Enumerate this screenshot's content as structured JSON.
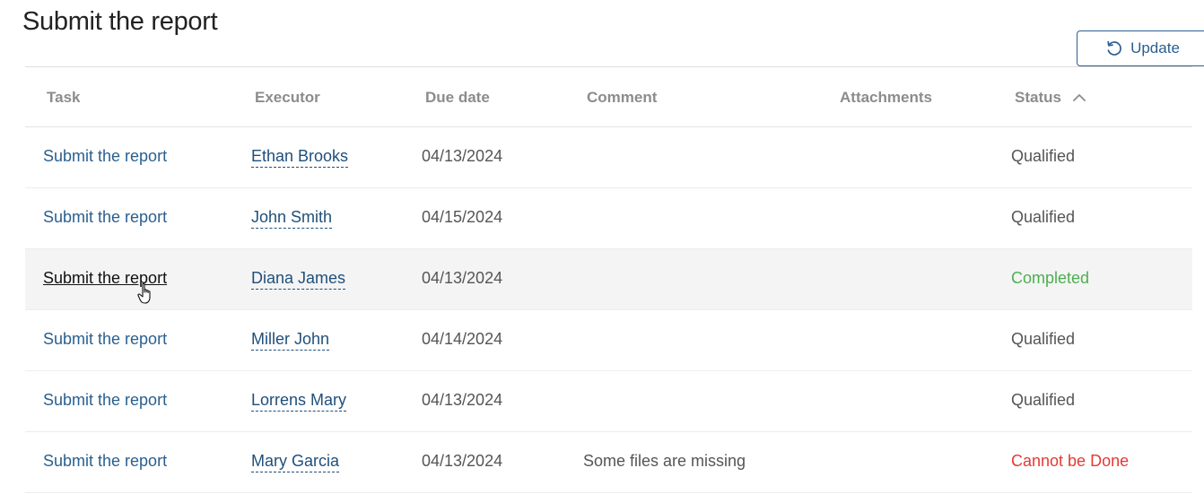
{
  "page": {
    "title": "Submit the report"
  },
  "toolbar": {
    "update_label": "Update",
    "update_icon": "refresh-icon"
  },
  "table": {
    "columns": {
      "task": "Task",
      "executor": "Executor",
      "due_date": "Due date",
      "comment": "Comment",
      "attachments": "Attachments",
      "status": "Status"
    },
    "sort": {
      "column": "status",
      "direction": "ascending",
      "icon": "chevron-up-icon"
    },
    "rows": [
      {
        "task": "Submit the report",
        "executor": "Ethan Brooks",
        "due_date": "04/13/2024",
        "comment": "",
        "attachments": "",
        "status": "Qualified",
        "status_kind": "qualified"
      },
      {
        "task": "Submit the report",
        "executor": "John Smith",
        "due_date": "04/15/2024",
        "comment": "",
        "attachments": "",
        "status": "Qualified",
        "status_kind": "qualified"
      },
      {
        "task": "Submit the report",
        "executor": "Diana James",
        "due_date": "04/13/2024",
        "comment": "",
        "attachments": "",
        "status": "Completed",
        "status_kind": "completed",
        "hovered": true
      },
      {
        "task": "Submit the report",
        "executor": "Miller John",
        "due_date": "04/14/2024",
        "comment": "",
        "attachments": "",
        "status": "Qualified",
        "status_kind": "qualified"
      },
      {
        "task": "Submit the report",
        "executor": "Lorrens Mary",
        "due_date": "04/13/2024",
        "comment": "",
        "attachments": "",
        "status": "Qualified",
        "status_kind": "qualified"
      },
      {
        "task": "Submit the report",
        "executor": "Mary Garcia",
        "due_date": "04/13/2024",
        "comment": "Some files are missing",
        "attachments": "",
        "status": "Cannot be Done",
        "status_kind": "cannot"
      }
    ]
  },
  "colors": {
    "link": "#2a5f8f",
    "executor_link": "#1f4f7a",
    "status_completed": "#4caf50",
    "status_cannot": "#e53935",
    "header_text": "#8c8c8c",
    "hover_row": "#f4f4f4"
  }
}
